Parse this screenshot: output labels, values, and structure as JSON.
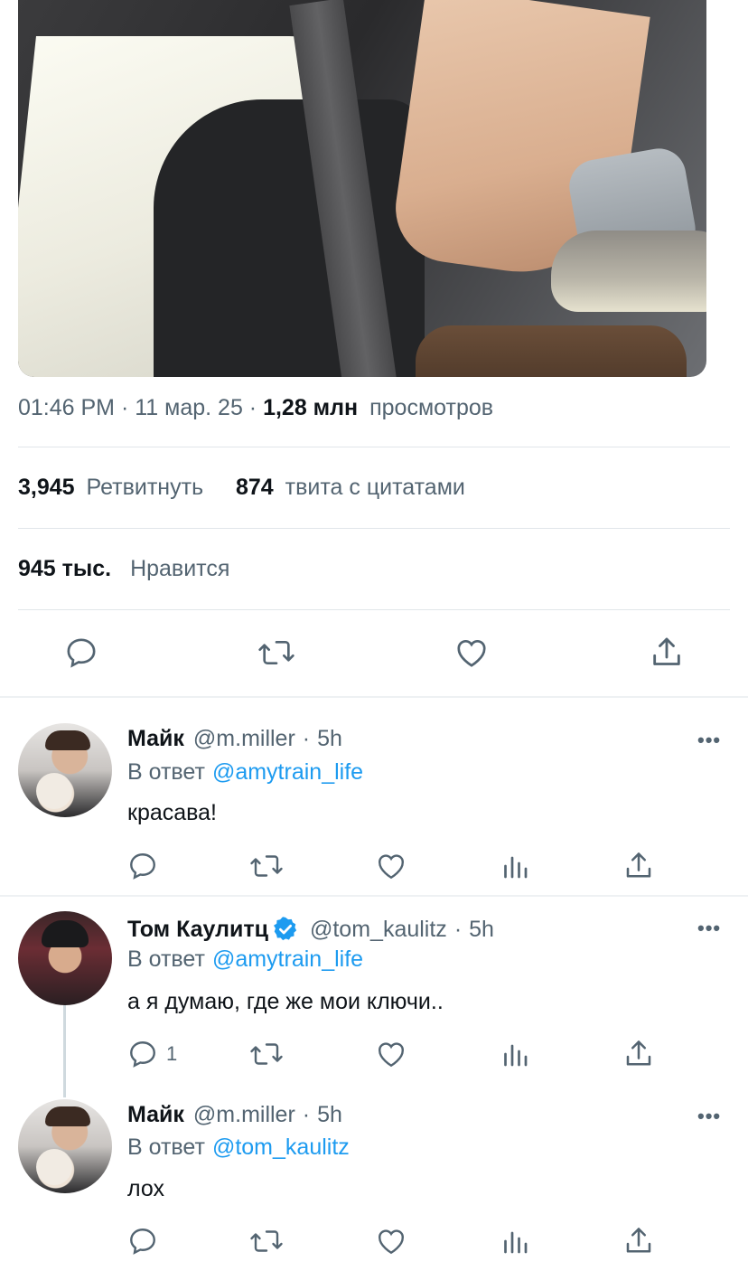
{
  "tweet": {
    "time": "01:46 PM",
    "date": "11 мар. 25",
    "views_count": "1,28 млн",
    "views_label": "просмотров",
    "retweets_count": "3,945",
    "retweets_label": "Ретвитнуть",
    "quotes_count": "874",
    "quotes_label": "твита с цитатами",
    "likes_count": "945 тыс.",
    "likes_label": "Нравится"
  },
  "replies": [
    {
      "name": "Майк",
      "handle": "@m.miller",
      "age": "5h",
      "reply_prefix": "В ответ",
      "reply_to": "@amytrain_life",
      "text": "красава!",
      "verified": false
    },
    {
      "name": "Том Каулитц",
      "handle": "@tom_kaulitz",
      "age": "5h",
      "reply_prefix": "В ответ",
      "reply_to": "@amytrain_life",
      "text": "а я думаю, где же мои ключи..",
      "reply_count": "1",
      "verified": true
    },
    {
      "name": "Майк",
      "handle": "@m.miller",
      "age": "5h",
      "reply_prefix": "В ответ",
      "reply_to": "@tom_kaulitz",
      "text": "лох",
      "verified": false
    }
  ],
  "ui": {
    "separator": "·",
    "more_label": "•••",
    "accent_color": "#1d9bf0",
    "icons": [
      "reply-icon",
      "retweet-icon",
      "like-icon",
      "analytics-icon",
      "share-icon",
      "verified-badge-icon"
    ]
  }
}
